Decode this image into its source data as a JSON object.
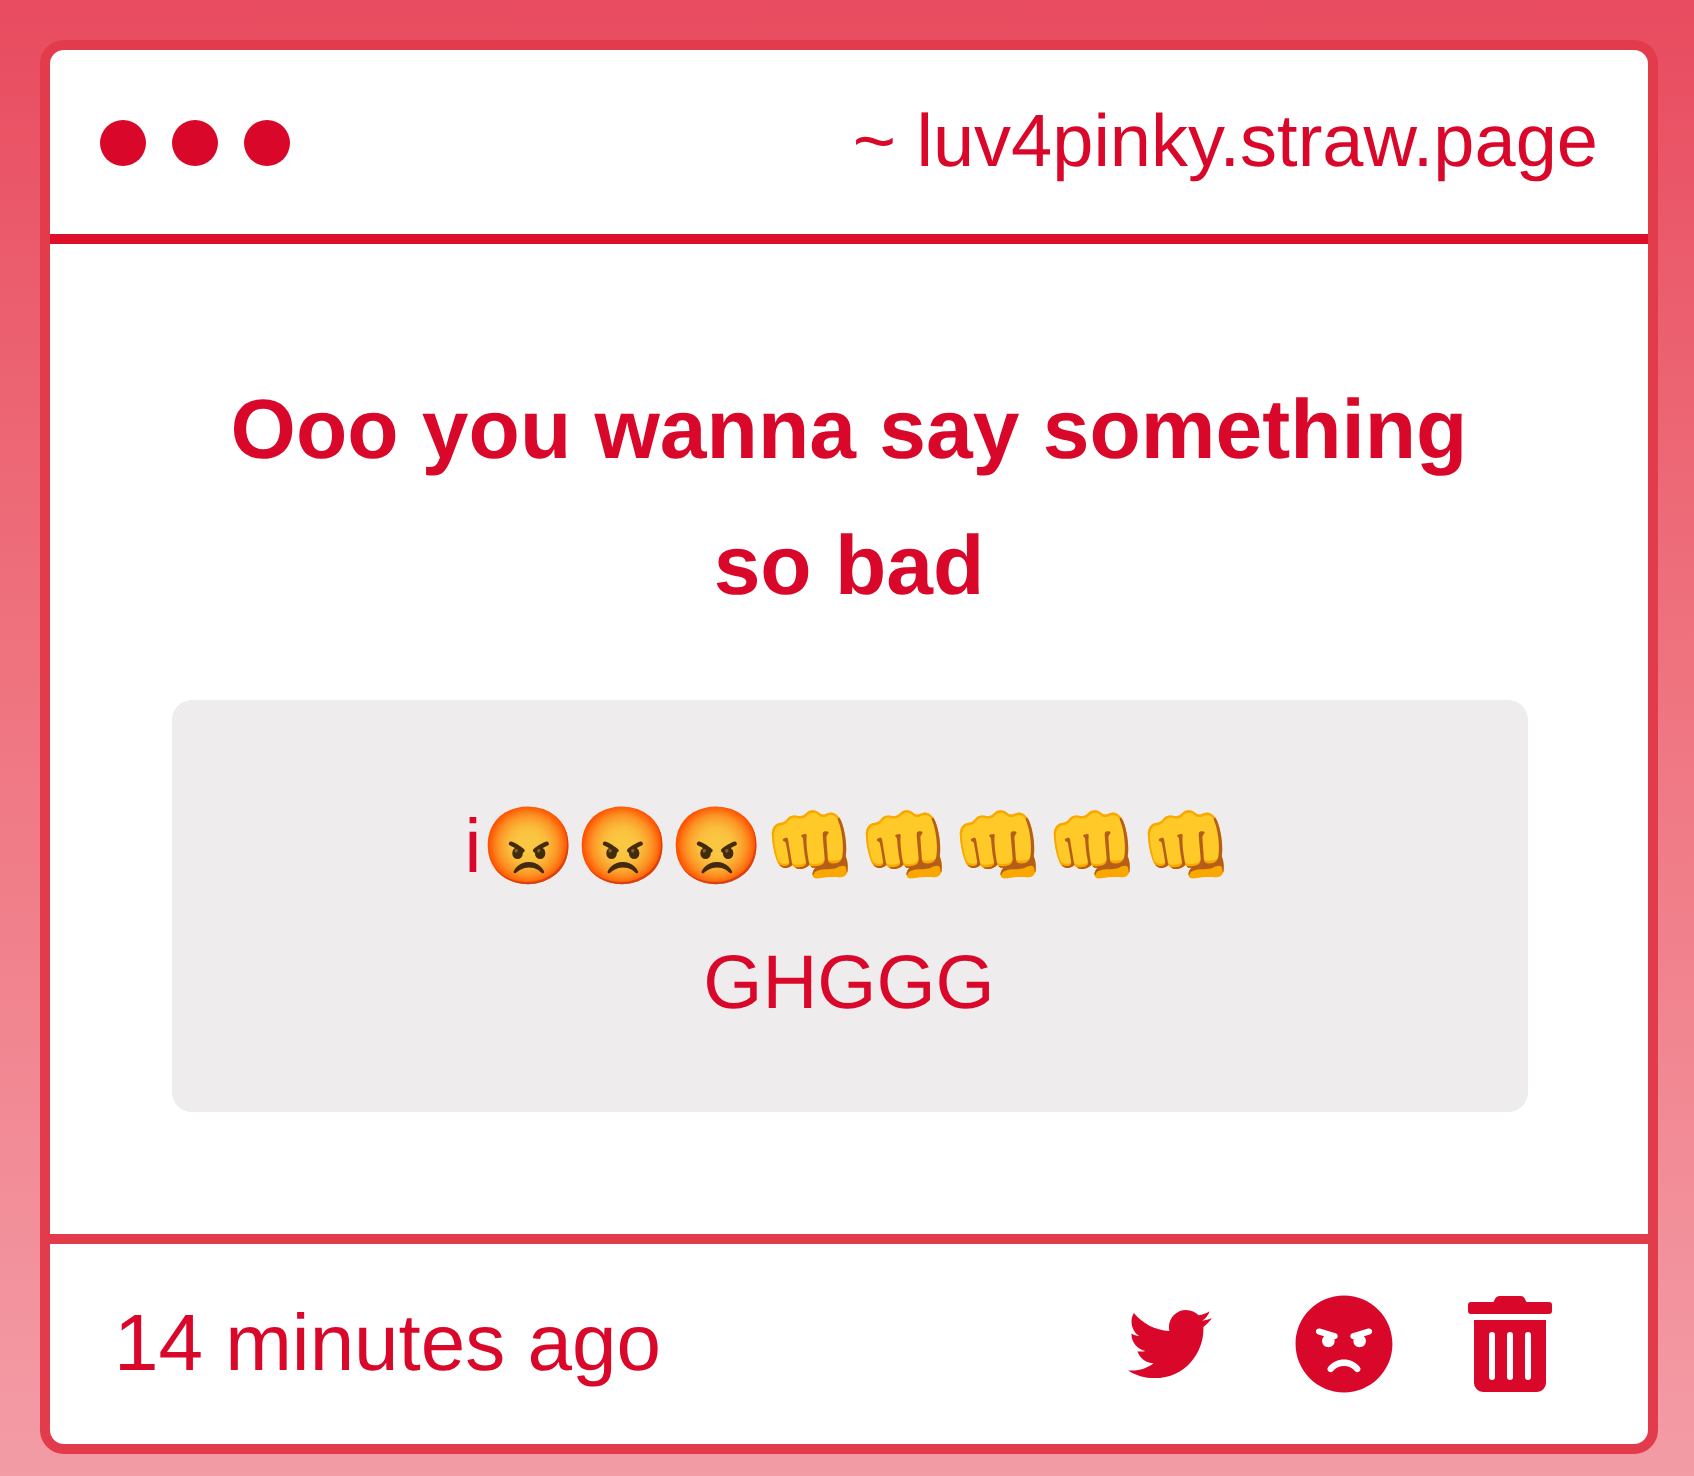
{
  "window": {
    "address": "~ luv4pinky.straw.page"
  },
  "post": {
    "title": "Ooo you wanna say something so bad",
    "message": "i😡😡😡👊👊👊👊👊 GHGGG"
  },
  "footer": {
    "time": "14 minutes ago"
  }
}
